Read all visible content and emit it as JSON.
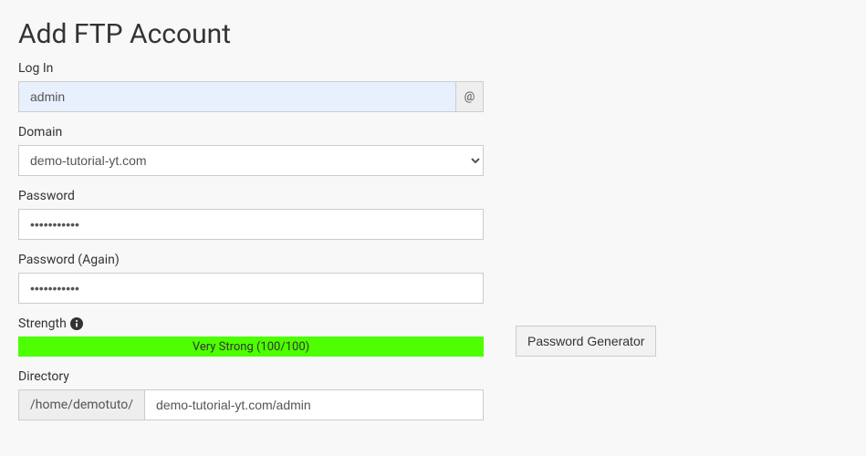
{
  "header": {
    "title": "Add FTP Account"
  },
  "form": {
    "login": {
      "label": "Log In",
      "value": "admin",
      "addon": "@"
    },
    "domain": {
      "label": "Domain",
      "value": "demo-tutorial-yt.com"
    },
    "password": {
      "label": "Password",
      "value": "•••••••••••"
    },
    "password_again": {
      "label": "Password (Again)",
      "value": "•••••••••••"
    },
    "strength": {
      "label": "Strength",
      "bar_text": "Very Strong (100/100)",
      "generator_button": "Password Generator"
    },
    "directory": {
      "label": "Directory",
      "prefix": "/home/demotuto/",
      "value": "demo-tutorial-yt.com/admin"
    }
  }
}
